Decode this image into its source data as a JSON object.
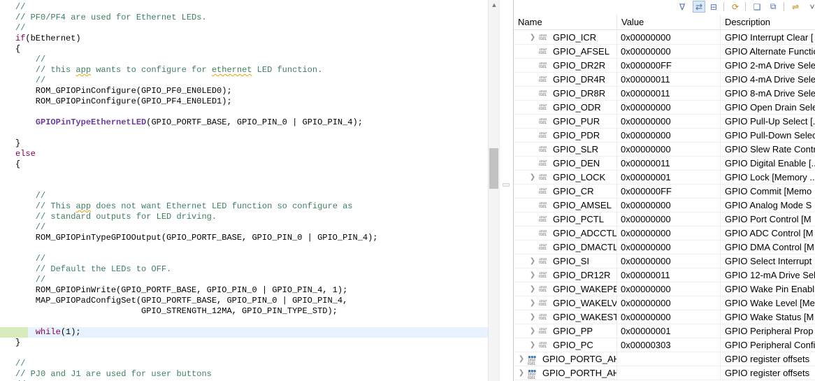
{
  "editor": {
    "lines": [
      [
        {
          "t": "//",
          "c": "comment"
        }
      ],
      [
        {
          "t": "// PF0/PF4 are used for Ethernet LEDs.",
          "c": "comment"
        }
      ],
      [
        {
          "t": "//",
          "c": "comment"
        }
      ],
      [
        {
          "t": "if",
          "c": "keyword"
        },
        {
          "t": "(bEthernet)",
          "c": "plain"
        }
      ],
      [
        {
          "t": "{",
          "c": "plain"
        }
      ],
      [
        {
          "t": "    //",
          "c": "comment"
        }
      ],
      [
        {
          "t": "    // this ",
          "c": "comment"
        },
        {
          "t": "app",
          "c": "comment-sq"
        },
        {
          "t": " wants to configure for ",
          "c": "comment"
        },
        {
          "t": "ethernet",
          "c": "comment-sq"
        },
        {
          "t": " LED function.",
          "c": "comment"
        }
      ],
      [
        {
          "t": "    //",
          "c": "comment"
        }
      ],
      [
        {
          "t": "    ROM_GPIOPinConfigure(GPIO_PF0_EN0LED0);",
          "c": "plain"
        }
      ],
      [
        {
          "t": "    ROM_GPIOPinConfigure(GPIO_PF4_EN0LED1);",
          "c": "plain"
        }
      ],
      [
        {
          "t": "",
          "c": "plain"
        }
      ],
      [
        {
          "t": "    ",
          "c": "plain"
        },
        {
          "t": "GPIOPinTypeEthernetLED",
          "c": "hl"
        },
        {
          "t": "(GPIO_PORTF_BASE, GPIO_PIN_0 | GPIO_PIN_4);",
          "c": "plain"
        }
      ],
      [
        {
          "t": "",
          "c": "plain"
        }
      ],
      [
        {
          "t": "}",
          "c": "plain"
        }
      ],
      [
        {
          "t": "else",
          "c": "keyword"
        }
      ],
      [
        {
          "t": "{",
          "c": "plain"
        }
      ],
      [
        {
          "t": "",
          "c": "plain"
        }
      ],
      [
        {
          "t": "",
          "c": "plain"
        }
      ],
      [
        {
          "t": "    //",
          "c": "comment"
        }
      ],
      [
        {
          "t": "    // This ",
          "c": "comment"
        },
        {
          "t": "app",
          "c": "comment-sq"
        },
        {
          "t": " does not want Ethernet LED function so configure as",
          "c": "comment"
        }
      ],
      [
        {
          "t": "    // standard outputs for LED driving.",
          "c": "comment"
        }
      ],
      [
        {
          "t": "    //",
          "c": "comment"
        }
      ],
      [
        {
          "t": "    ROM_GPIOPinTypeGPIOOutput(GPIO_PORTF_BASE, GPIO_PIN_0 | GPIO_PIN_4);",
          "c": "plain"
        }
      ],
      [
        {
          "t": "",
          "c": "plain"
        }
      ],
      [
        {
          "t": "    //",
          "c": "comment"
        }
      ],
      [
        {
          "t": "    // Default the LEDs to OFF.",
          "c": "comment"
        }
      ],
      [
        {
          "t": "    //",
          "c": "comment"
        }
      ],
      [
        {
          "t": "    ROM_GPIOPinWrite(GPIO_PORTF_BASE, GPIO_PIN_0 | GPIO_PIN_4, 1);",
          "c": "plain"
        }
      ],
      [
        {
          "t": "    MAP_GPIOPadConfigSet(GPIO_PORTF_BASE, GPIO_PIN_0 | GPIO_PIN_4,",
          "c": "plain"
        }
      ],
      [
        {
          "t": "                         GPIO_STRENGTH_12MA, GPIO_PIN_TYPE_STD);",
          "c": "plain"
        }
      ],
      [
        {
          "t": "",
          "c": "plain"
        }
      ],
      [
        {
          "t": "    ",
          "c": "plain"
        },
        {
          "t": "while",
          "c": "keyword"
        },
        {
          "t": "(1);",
          "c": "plain"
        }
      ],
      [
        {
          "t": "}",
          "c": "plain"
        }
      ],
      [
        {
          "t": "",
          "c": "plain"
        }
      ],
      [
        {
          "t": "//",
          "c": "comment"
        }
      ],
      [
        {
          "t": "// PJ0 and J1 are used for user buttons",
          "c": "comment"
        }
      ],
      [
        {
          "t": "//",
          "c": "comment"
        }
      ]
    ],
    "current_line": 31
  },
  "registers": {
    "columns": {
      "name": "Name",
      "value": "Value",
      "description": "Description"
    },
    "toolbar_icons": [
      "arrange-icon",
      "link-icon",
      "collapse-all-icon",
      "refresh-icon",
      "new-group-icon",
      "export-icon",
      "sync-icon",
      "view-menu-icon"
    ],
    "rows": [
      {
        "name": "GPIO_ICR",
        "value": "0x00000000",
        "desc": "GPIO Interrupt Clear [",
        "expandable": true,
        "kind": "register"
      },
      {
        "name": "GPIO_AFSEL",
        "value": "0x00000000",
        "desc": "GPIO Alternate Functio",
        "expandable": false,
        "kind": "register"
      },
      {
        "name": "GPIO_DR2R",
        "value": "0x000000FF",
        "desc": "GPIO 2-mA Drive Sele",
        "expandable": false,
        "kind": "register"
      },
      {
        "name": "GPIO_DR4R",
        "value": "0x00000011",
        "desc": "GPIO 4-mA Drive Sele",
        "expandable": false,
        "kind": "register"
      },
      {
        "name": "GPIO_DR8R",
        "value": "0x00000011",
        "desc": "GPIO 8-mA Drive Sele",
        "expandable": false,
        "kind": "register"
      },
      {
        "name": "GPIO_ODR",
        "value": "0x00000000",
        "desc": "GPIO Open Drain Sele",
        "expandable": false,
        "kind": "register"
      },
      {
        "name": "GPIO_PUR",
        "value": "0x00000000",
        "desc": "GPIO Pull-Up Select [..",
        "expandable": false,
        "kind": "register"
      },
      {
        "name": "GPIO_PDR",
        "value": "0x00000000",
        "desc": "GPIO Pull-Down Selec",
        "expandable": false,
        "kind": "register"
      },
      {
        "name": "GPIO_SLR",
        "value": "0x00000000",
        "desc": "GPIO Slew Rate Contr",
        "expandable": false,
        "kind": "register"
      },
      {
        "name": "GPIO_DEN",
        "value": "0x00000011",
        "desc": "GPIO Digital Enable [..",
        "expandable": false,
        "kind": "register"
      },
      {
        "name": "GPIO_LOCK",
        "value": "0x00000001",
        "desc": "GPIO Lock [Memory ..",
        "expandable": true,
        "kind": "register"
      },
      {
        "name": "GPIO_CR",
        "value": "0x000000FF",
        "desc": "GPIO Commit [Memo",
        "expandable": false,
        "kind": "register"
      },
      {
        "name": "GPIO_AMSEL",
        "value": "0x00000000",
        "desc": "GPIO Analog Mode S",
        "expandable": false,
        "kind": "register"
      },
      {
        "name": "GPIO_PCTL",
        "value": "0x00000000",
        "desc": "GPIO Port Control [M",
        "expandable": false,
        "kind": "register"
      },
      {
        "name": "GPIO_ADCCTL",
        "value": "0x00000000",
        "desc": "GPIO ADC Control [M",
        "expandable": false,
        "kind": "register"
      },
      {
        "name": "GPIO_DMACTL",
        "value": "0x00000000",
        "desc": "GPIO DMA Control [M",
        "expandable": false,
        "kind": "register"
      },
      {
        "name": "GPIO_SI",
        "value": "0x00000000",
        "desc": "GPIO Select Interrupt",
        "expandable": true,
        "kind": "register"
      },
      {
        "name": "GPIO_DR12R",
        "value": "0x00000011",
        "desc": "GPIO 12-mA Drive Sel",
        "expandable": true,
        "kind": "register"
      },
      {
        "name": "GPIO_WAKEPEN",
        "value": "0x00000000",
        "desc": "GPIO Wake Pin Enabl",
        "expandable": true,
        "kind": "register"
      },
      {
        "name": "GPIO_WAKELVL",
        "value": "0x00000000",
        "desc": "GPIO Wake Level [Me",
        "expandable": true,
        "kind": "register"
      },
      {
        "name": "GPIO_WAKESTA",
        "value": "0x00000000",
        "desc": "GPIO Wake Status [M",
        "expandable": true,
        "kind": "register"
      },
      {
        "name": "GPIO_PP",
        "value": "0x00000001",
        "desc": "GPIO Peripheral Prop",
        "expandable": true,
        "kind": "register"
      },
      {
        "name": "GPIO_PC",
        "value": "0x00000303",
        "desc": "GPIO Peripheral Confi",
        "expandable": true,
        "kind": "register"
      },
      {
        "name": "GPIO_PORTG_AHB",
        "value": "",
        "desc": "GPIO register offsets",
        "expandable": true,
        "kind": "group"
      },
      {
        "name": "GPIO_PORTH_AHB",
        "value": "",
        "desc": "GPIO register offsets",
        "expandable": true,
        "kind": "group"
      }
    ]
  }
}
